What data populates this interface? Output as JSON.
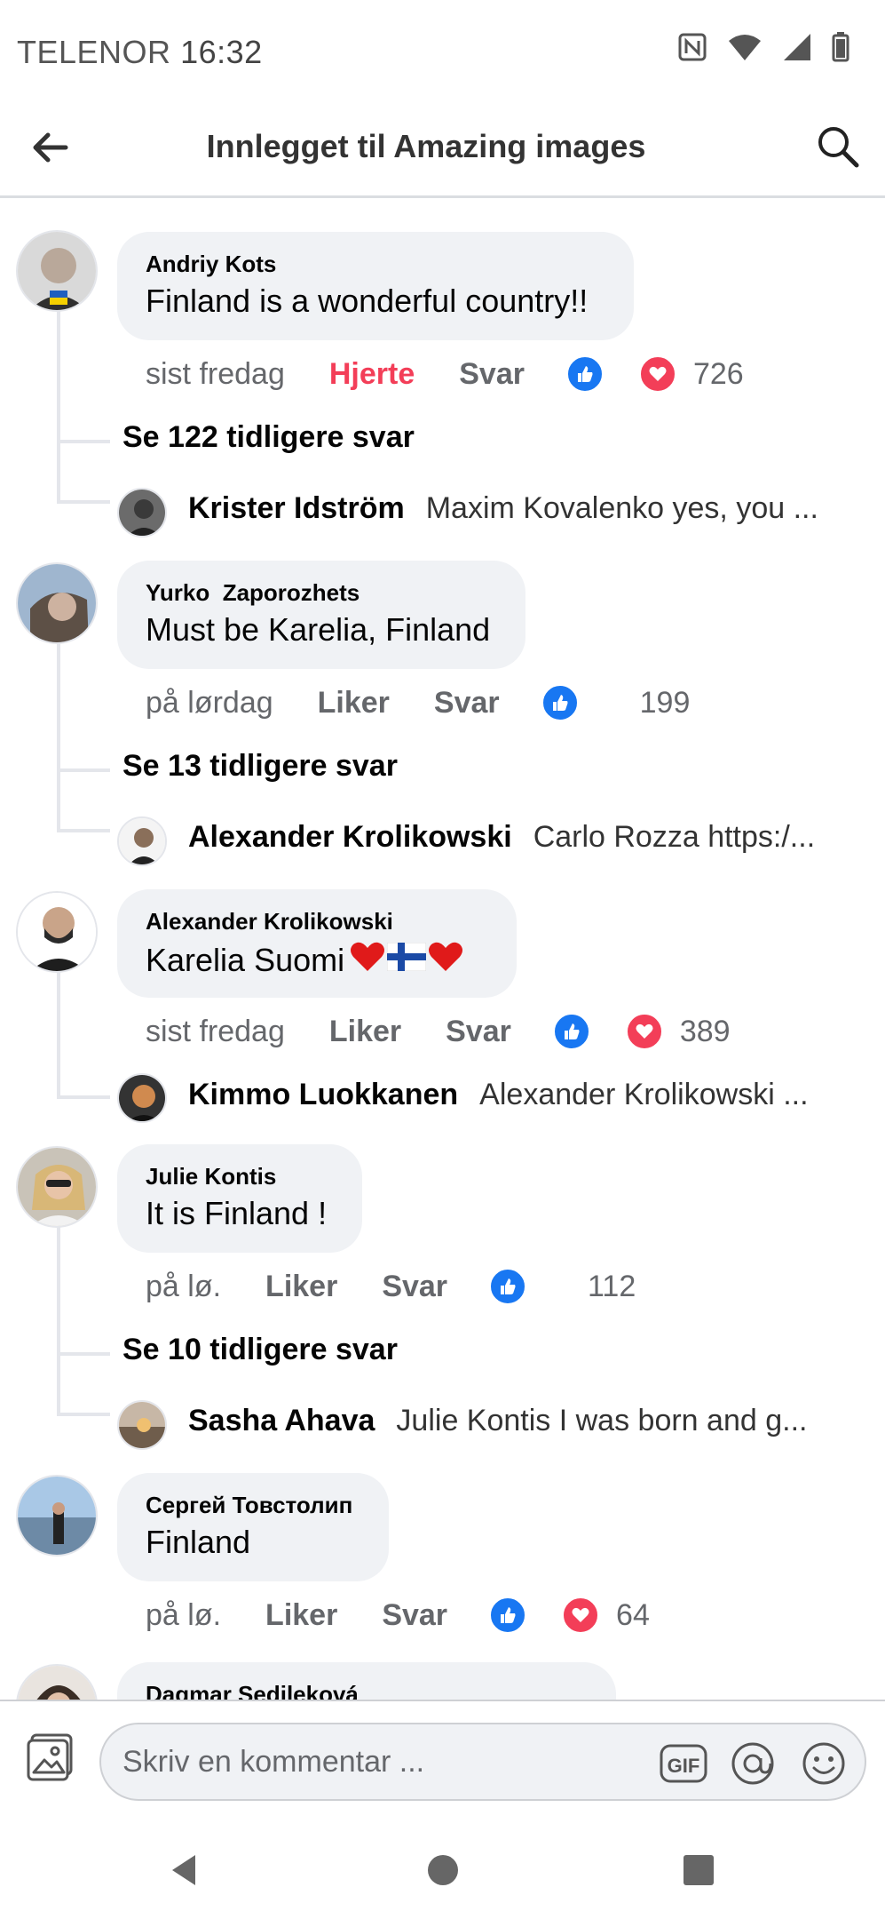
{
  "status_bar": {
    "carrier": "TELENOR",
    "time": "16:32"
  },
  "header": {
    "title": "Innlegget til Amazing images"
  },
  "comments": [
    {
      "author": "Andriy Kots",
      "text": "Finland is a wonderful country!!",
      "time": "sist fredag",
      "like_label": "Hjerte",
      "reply_label": "Svar",
      "reactions": [
        "like",
        "love"
      ],
      "count": "726",
      "more_replies": "Se 122 tidligere svar",
      "last_reply": {
        "author": "Krister Idström",
        "text": "Maxim Kovalenko yes, you ..."
      }
    },
    {
      "author": "Yurko  Zaporozhets",
      "text": "Must be Karelia, Finland",
      "time": "på lørdag",
      "like_label": "Liker",
      "reply_label": "Svar",
      "reactions": [
        "like"
      ],
      "count": "199",
      "more_replies": "Se 13 tidligere svar",
      "last_reply": {
        "author": "Alexander Krolikowski",
        "text": "Carlo Rozza https:/..."
      }
    },
    {
      "author": "Alexander Krolikowski",
      "text": "Karelia Suomi",
      "time": "sist fredag",
      "like_label": "Liker",
      "reply_label": "Svar",
      "reactions": [
        "like",
        "love"
      ],
      "count": "389",
      "last_reply": {
        "author": "Kimmo Luokkanen",
        "text": "Alexander Krolikowski ..."
      }
    },
    {
      "author": "Julie Kontis",
      "text": "It is Finland !",
      "time": "på lø.",
      "like_label": "Liker",
      "reply_label": "Svar",
      "reactions": [
        "like"
      ],
      "count": "112",
      "more_replies": "Se 10 tidligere svar",
      "last_reply": {
        "author": "Sasha Ahava",
        "text": "Julie Kontis I was born and g..."
      }
    },
    {
      "author": "Сергей Товстолип",
      "text": "Finland",
      "time": "på lø.",
      "like_label": "Liker",
      "reply_label": "Svar",
      "reactions": [
        "like",
        "love"
      ],
      "count": "64"
    },
    {
      "author": "Dagmar Sedileková"
    }
  ],
  "composer": {
    "placeholder": "Skriv en kommentar ...",
    "gif_label": "GIF"
  },
  "colors": {
    "accent": "#1877f2",
    "love": "#f33e58",
    "bubble": "#f0f2f5",
    "muted": "#65676b"
  },
  "icons": [
    "back-arrow-icon",
    "search-icon",
    "photo-icon",
    "gif-icon",
    "at-icon",
    "emoji-icon",
    "nfc-icon",
    "wifi-icon",
    "signal-icon",
    "battery-icon"
  ]
}
